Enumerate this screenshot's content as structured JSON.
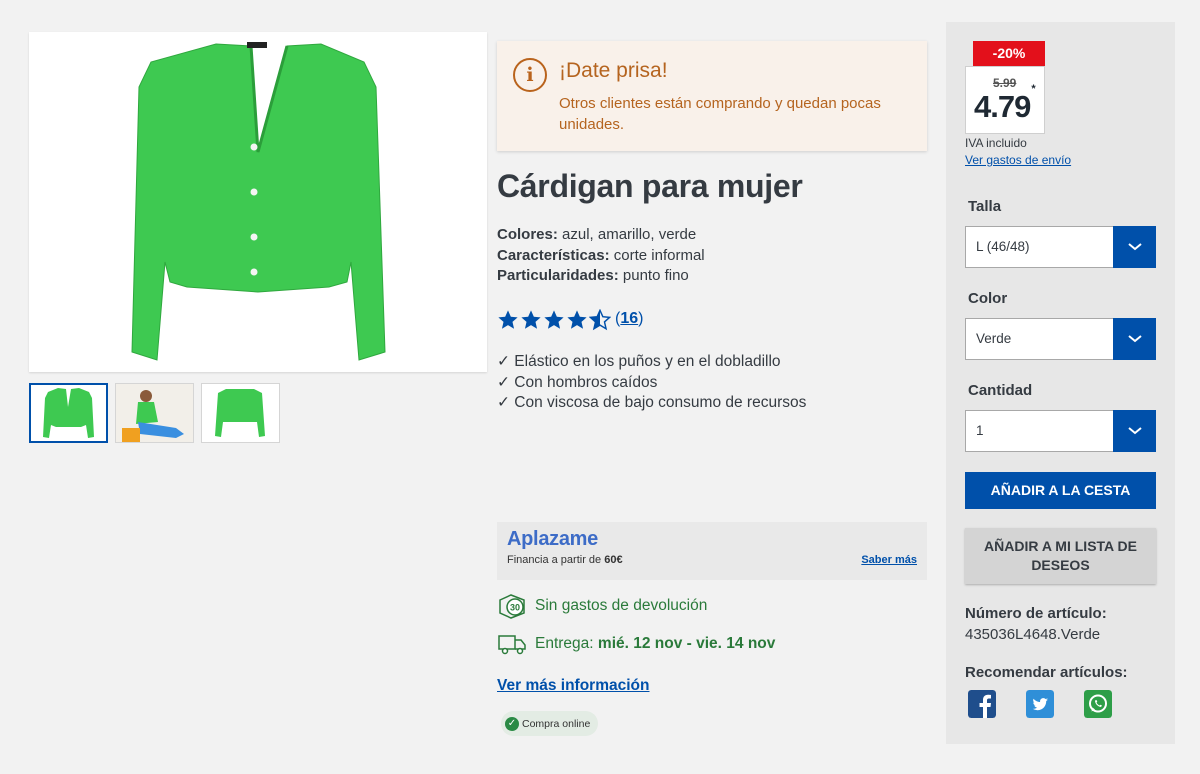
{
  "hurry": {
    "title": "¡Date prisa!",
    "text": "Otros clientes están comprando y quedan pocas unidades."
  },
  "product": {
    "title": "Cárdigan para mujer",
    "attributes": [
      {
        "label": "Colores:",
        "value": "azul, amarillo, verde"
      },
      {
        "label": "Características:",
        "value": "corte informal"
      },
      {
        "label": "Particularidades:",
        "value": "punto fino"
      }
    ],
    "rating": {
      "stars": 4.5,
      "count": "16"
    },
    "features": [
      "✓ Elástico en los puños y en el dobladillo",
      "✓ Con hombros caídos",
      "✓ Con viscosa de bajo consumo de recursos"
    ],
    "main_image_color": "#3ec951"
  },
  "aplazame": {
    "logo": "Aplazame",
    "text": "Financia a partir de",
    "amount": "60€",
    "link": "Saber más"
  },
  "perks": {
    "returns": "Sin gastos de devolución",
    "returns_icon_number": "30",
    "delivery_label": "Entrega:",
    "delivery_dates": "mié. 12 nov - vie. 14 nov"
  },
  "more_info": "Ver más información",
  "online_badge": "Compra online",
  "price": {
    "discount": "-20%",
    "old": "5.99",
    "new": "4.79",
    "asterisk": "*",
    "vat": "IVA incluido",
    "shipping": "Ver gastos de envío"
  },
  "selectors": {
    "size": {
      "label": "Talla",
      "value": "L (46/48)"
    },
    "color": {
      "label": "Color",
      "value": "Verde"
    },
    "quantity": {
      "label": "Cantidad",
      "value": "1"
    }
  },
  "buttons": {
    "add_to_cart": "AÑADIR A LA CESTA",
    "wishlist_line1": "AÑADIR A MI LISTA DE",
    "wishlist_line2": "DESEOS"
  },
  "article": {
    "label": "Número de artículo:",
    "value": "435036L4648.Verde"
  },
  "recommend": {
    "label": "Recomendar artículos:",
    "networks": [
      "facebook-icon",
      "twitter-icon",
      "whatsapp-icon"
    ]
  },
  "colors": {
    "brand_blue": "#0050aa",
    "sale_red": "#e3101b",
    "hurry_orange": "#b5641f",
    "perk_green": "#2a7a3a"
  }
}
